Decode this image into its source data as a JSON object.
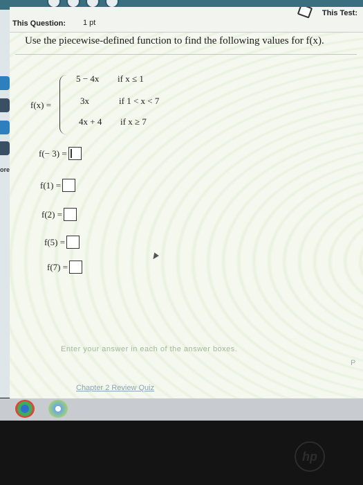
{
  "header": {
    "question_label": "This Question:",
    "points": "1 pt",
    "test_label": "This Test:"
  },
  "instruction": "Use the piecewise-defined function to find the following values for f(x).",
  "function": {
    "name": "f(x) =",
    "pieces": [
      {
        "expr": "5 − 4x",
        "cond": "if x ≤ 1"
      },
      {
        "expr": "3x",
        "cond": "if 1 < x < 7"
      },
      {
        "expr": "4x + 4",
        "cond": "if x ≥ 7"
      }
    ]
  },
  "answers": [
    {
      "label": "f(− 3) =",
      "value": ""
    },
    {
      "label": "f(1) =",
      "value": ""
    },
    {
      "label": "f(2) =",
      "value": ""
    },
    {
      "label": "f(5) =",
      "value": ""
    },
    {
      "label": "f(7) =",
      "value": ""
    }
  ],
  "sidebar": {
    "more_label": "ore"
  },
  "hint": "Enter your answer in each of the answer boxes.",
  "footer_link": "Chapter 2 Review Quiz",
  "side_button": "P",
  "logo": "hp",
  "colors": {
    "accent": "#2d7fc0",
    "background": "#f4f8ee"
  }
}
